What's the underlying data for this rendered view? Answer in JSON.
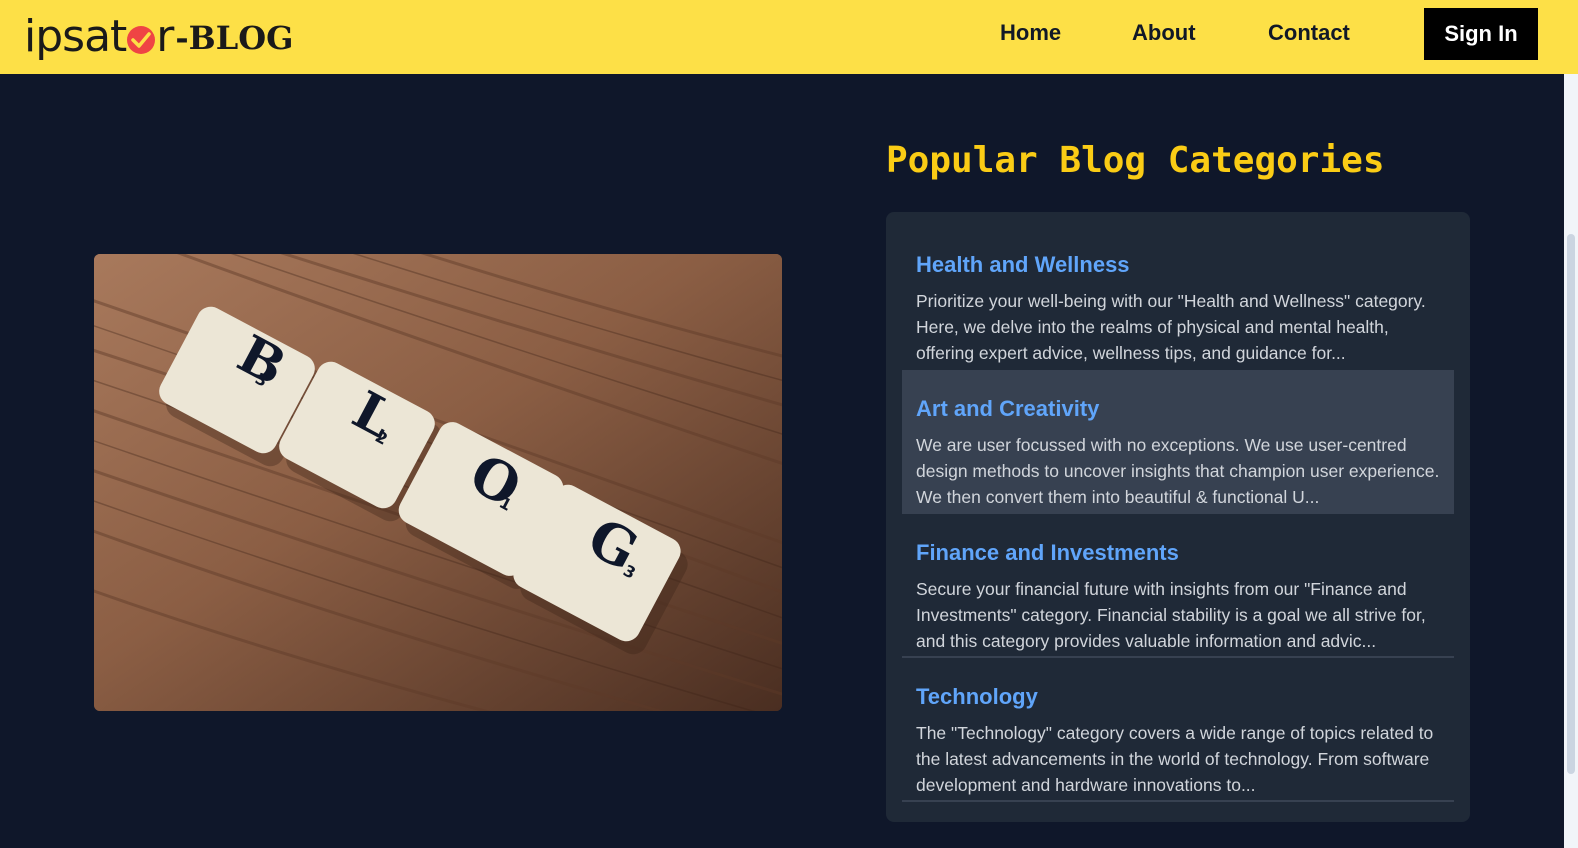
{
  "header": {
    "logo_main_a": "ipsat",
    "logo_main_b": "r",
    "logo_suffix": "-BLOG",
    "nav": [
      "Home",
      "About",
      "Contact"
    ],
    "signin_label": "Sign In"
  },
  "hero": {
    "image_label": "BLOG",
    "tiles": [
      "B",
      "L",
      "O",
      "G"
    ],
    "tile_scores": [
      "3",
      "2",
      "1",
      "3"
    ]
  },
  "categories": {
    "title": "Popular Blog Categories",
    "items": [
      {
        "title": "Health and Wellness",
        "desc": "Prioritize your well-being with our \"Health and Wellness\" category. Here, we delve into the realms of physical and mental health, offering expert advice, wellness tips, and guidance for..."
      },
      {
        "title": "Art and Creativity",
        "desc": "We are user focussed with no exceptions. We use user-centred design methods to uncover insights that champion user experience. We then convert them into beautiful & functional U..."
      },
      {
        "title": "Finance and Investments",
        "desc": "Secure your financial future with insights from our \"Finance and Investments\" category. Financial stability is a goal we all strive for, and this category provides valuable information and advic..."
      },
      {
        "title": "Technology",
        "desc": "The \"Technology\" category covers a wide range of topics related to the latest advancements in the world of technology. From software development and hardware innovations to..."
      }
    ]
  },
  "colors": {
    "nav_bg": "#fde047",
    "page_bg": "#0f172a",
    "heading": "#facc15",
    "link": "#60a5fa",
    "panel": "#1f2937",
    "highlight": "#374151",
    "logo_accent": "#ef4444"
  },
  "icons": [
    "checkmark-o-icon"
  ]
}
